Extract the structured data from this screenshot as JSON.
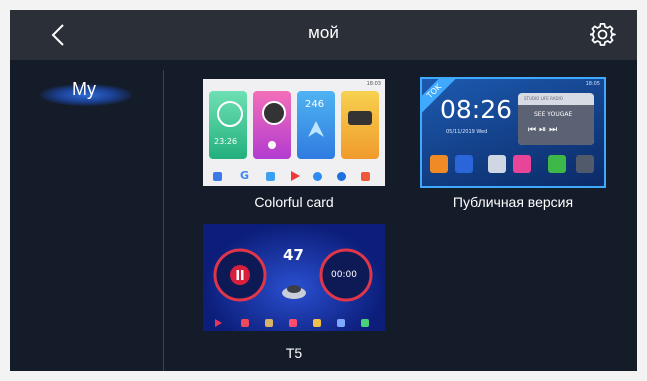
{
  "header": {
    "title": "мой",
    "back_icon": "chevron-left-icon",
    "settings_icon": "gear-icon"
  },
  "sidebar": {
    "items": [
      {
        "label": "My",
        "selected": true
      }
    ]
  },
  "themes": [
    {
      "name": "Colorful card",
      "selected": false,
      "preview": {
        "status_time": "18:03",
        "clock": "23:26",
        "temp": "246"
      }
    },
    {
      "name": "Публичная версия",
      "selected": true,
      "preview": {
        "corner_badge": "TOK",
        "clock": "08:26",
        "date": "05/11/2019 Wed",
        "status_time": "18:05",
        "player_station": "STUDIO LIFE RADIO",
        "player_title": "SEE YOUGAE"
      }
    },
    {
      "name": "T5",
      "selected": false,
      "preview": {
        "speed": "47",
        "gauge_time": "00:00"
      }
    }
  ],
  "colors": {
    "background": "#141c2a",
    "topbar": "#2a2f38",
    "accent": "#3fa9ff"
  }
}
